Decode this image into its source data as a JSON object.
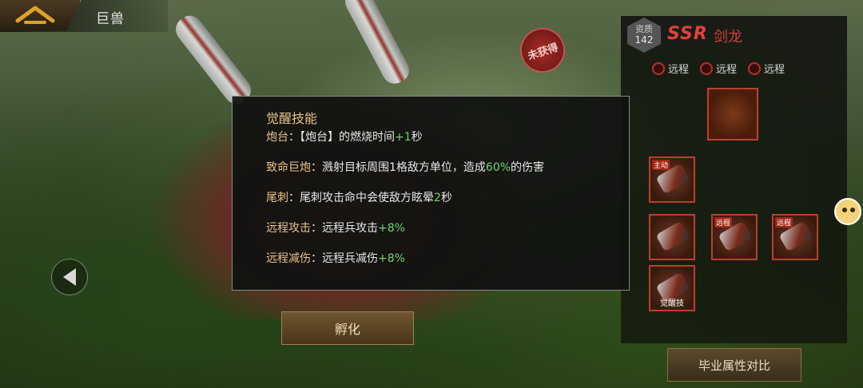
{
  "header": {
    "title": "巨兽"
  },
  "badge": {
    "not_obtained": "未获得"
  },
  "buttons": {
    "hatch": "孵化",
    "compare": "毕业属性对比"
  },
  "dino": {
    "quality_label": "资质",
    "quality_value": "142",
    "rarity": "SSR",
    "name": "剑龙",
    "range_tags": [
      "远程",
      "远程",
      "远程"
    ]
  },
  "skills": {
    "main_tag": "主动",
    "ranged_tag": "远程",
    "awaken_tag": "觉醒技"
  },
  "popup": {
    "title": "觉醒技能",
    "lines": [
      {
        "name": "炮台",
        "sep": "：",
        "text_a": "【炮台】的燃烧时间",
        "num": "+1",
        "text_b": "秒"
      },
      {
        "name": "致命巨炮",
        "sep": "：",
        "text_a": "溅射目标周围1格敌方单位，造成",
        "num": "60%",
        "text_b": "的伤害"
      },
      {
        "name": "尾刺",
        "sep": "：",
        "text_a": "尾刺攻击命中会使敌方眩晕",
        "num": "2",
        "text_b": "秒"
      },
      {
        "name": "远程攻击",
        "sep": "：",
        "text_a": "远程兵攻击",
        "num": "+8%",
        "text_b": ""
      },
      {
        "name": "远程减伤",
        "sep": "：",
        "text_a": "远程兵减伤",
        "num": "+8%",
        "text_b": ""
      }
    ]
  },
  "colors": {
    "accent_gold": "#e8c48a",
    "buff_green": "#6fd36f",
    "rarity_red": "#e24040"
  }
}
